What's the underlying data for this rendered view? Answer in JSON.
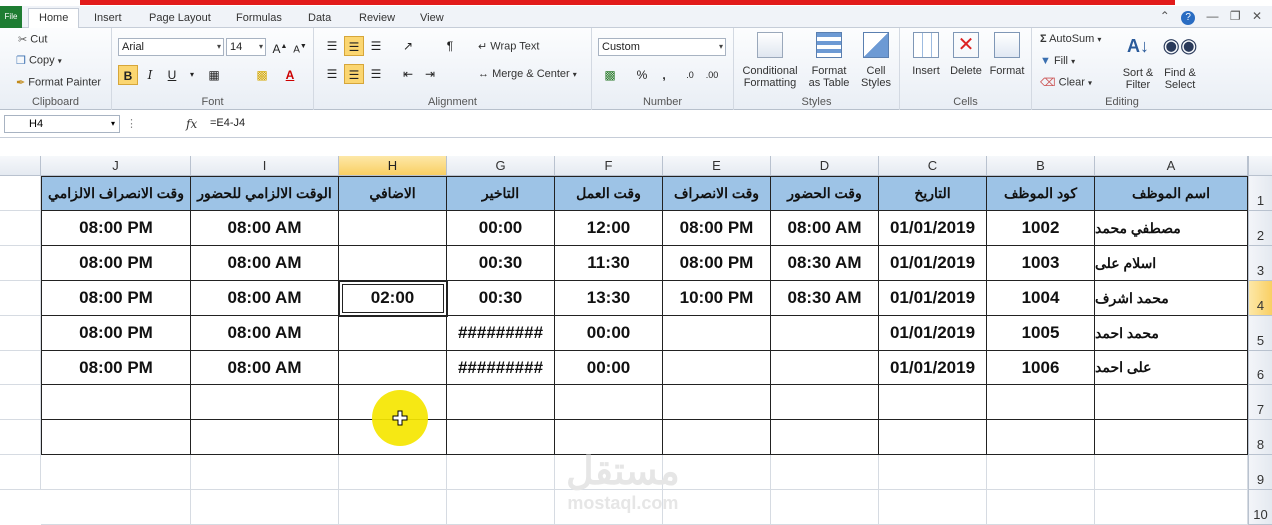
{
  "ribbon_tabs": {
    "file": "File",
    "home": "Home",
    "insert": "Insert",
    "page_layout": "Page Layout",
    "formulas": "Formulas",
    "data": "Data",
    "review": "Review",
    "view": "View"
  },
  "clipboard": {
    "cut": "Cut",
    "copy": "Copy",
    "format_painter": "Format Painter",
    "label": "Clipboard"
  },
  "font": {
    "family": "Arial",
    "size": "14",
    "label": "Font",
    "bold": "B",
    "italic": "I",
    "underline": "U"
  },
  "alignment": {
    "wrap_text": "Wrap Text",
    "merge_center": "Merge & Center",
    "label": "Alignment"
  },
  "number": {
    "format": "Custom",
    "percent": "%",
    "comma": ",",
    "label": "Number"
  },
  "styles": {
    "conditional_1": "Conditional",
    "conditional_2": "Formatting",
    "format_table_1": "Format",
    "format_table_2": "as Table",
    "cell_styles_1": "Cell",
    "cell_styles_2": "Styles",
    "label": "Styles"
  },
  "cells": {
    "insert": "Insert",
    "delete": "Delete",
    "format": "Format",
    "label": "Cells"
  },
  "editing": {
    "autosum": "AutoSum",
    "fill": "Fill",
    "clear": "Clear",
    "sort_1": "Sort &",
    "sort_2": "Filter",
    "find_1": "Find &",
    "find_2": "Select",
    "label": "Editing"
  },
  "formula_bar": {
    "name_box": "H4",
    "fx": "fx",
    "formula": "=E4-J4"
  },
  "columns": [
    "J",
    "I",
    "H",
    "G",
    "F",
    "E",
    "D",
    "C",
    "B",
    "A"
  ],
  "rows": [
    "1",
    "2",
    "3",
    "4",
    "5",
    "6",
    "7",
    "8",
    "9",
    "10"
  ],
  "table": {
    "headers": [
      "وقت الانصراف الالزامي",
      "الوقت الالزامي للحضور",
      "الاضافي",
      "التاخير",
      "وقت العمل",
      "وقت الانصراف",
      "وقت الحضور",
      "التاريخ",
      "كود الموظف",
      "اسم الموظف"
    ],
    "rows": [
      [
        "08:00 PM",
        "08:00 AM",
        "",
        "00:00",
        "12:00",
        "08:00 PM",
        "08:00 AM",
        "01/01/2019",
        "1002",
        "مصطفي محمد"
      ],
      [
        "08:00 PM",
        "08:00 AM",
        "",
        "00:30",
        "11:30",
        "08:00 PM",
        "08:30 AM",
        "01/01/2019",
        "1003",
        "اسلام على"
      ],
      [
        "08:00 PM",
        "08:00 AM",
        "02:00",
        "00:30",
        "13:30",
        "10:00 PM",
        "08:30 AM",
        "01/01/2019",
        "1004",
        "محمد اشرف"
      ],
      [
        "08:00 PM",
        "08:00 AM",
        "",
        "#########",
        "00:00",
        "",
        "",
        "01/01/2019",
        "1005",
        "محمد احمد"
      ],
      [
        "08:00 PM",
        "08:00 AM",
        "",
        "#########",
        "00:00",
        "",
        "",
        "01/01/2019",
        "1006",
        "على احمد"
      ]
    ]
  },
  "watermark": {
    "arabic": "مستقل",
    "latin": "mostaql.com"
  }
}
